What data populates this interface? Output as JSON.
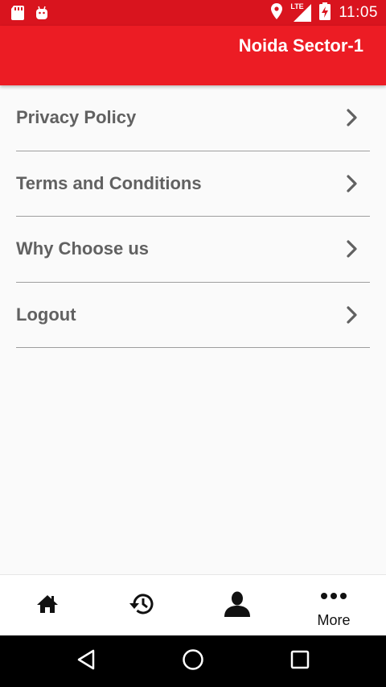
{
  "status_bar": {
    "time": "11:05",
    "network_label": "LTE",
    "icons": [
      "sd-card-icon",
      "android-icon",
      "location-icon",
      "signal-icon",
      "battery-charging-icon"
    ]
  },
  "app_bar": {
    "title": "Noida Sector-1",
    "background_color": "#ec1c24"
  },
  "menu": {
    "items": [
      {
        "label": "Privacy Policy",
        "icon": "chevron-right-icon"
      },
      {
        "label": "Terms and Conditions",
        "icon": "chevron-right-icon"
      },
      {
        "label": "Why Choose us",
        "icon": "chevron-right-icon"
      },
      {
        "label": "Logout",
        "icon": "chevron-right-icon"
      }
    ]
  },
  "bottom_nav": {
    "items": [
      {
        "icon": "home-icon"
      },
      {
        "icon": "history-icon"
      },
      {
        "icon": "profile-icon"
      },
      {
        "icon": "more-icon",
        "label": "More"
      }
    ]
  },
  "system_nav": {
    "buttons": [
      "back-icon",
      "home-circle-icon",
      "recents-icon"
    ]
  }
}
